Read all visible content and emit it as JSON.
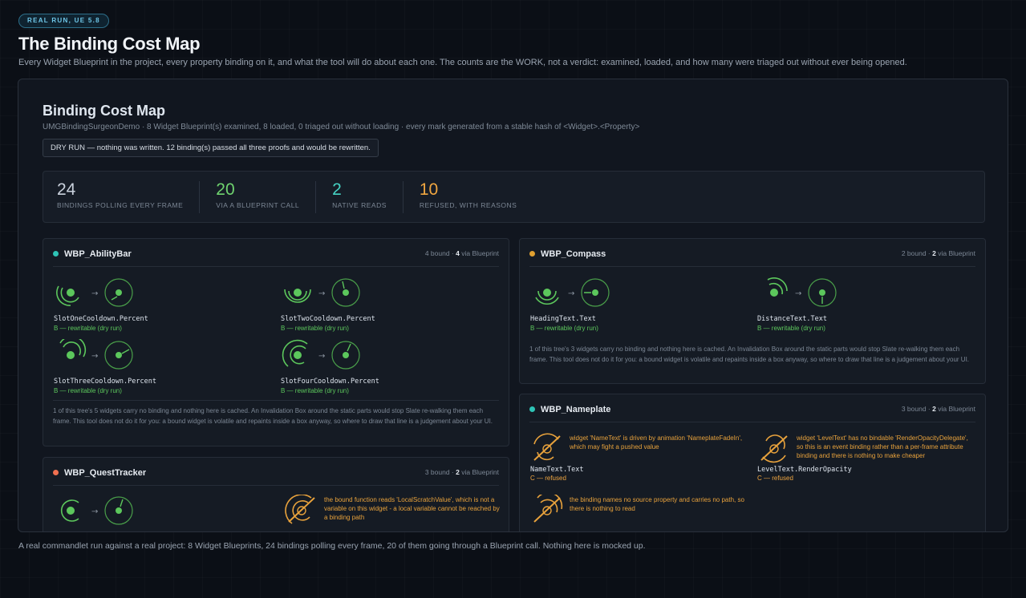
{
  "badge": "REAL RUN, UE 5.8",
  "title": "The Binding Cost Map",
  "subtitle": "Every Widget Blueprint in the project, every property binding on it, and what the tool will do about each one. The counts are the WORK, not a verdict: examined, loaded, and how many were triaged out without ever being opened.",
  "map": {
    "title": "Binding Cost Map",
    "meta": "UMGBindingSurgeonDemo · 8 Widget Blueprint(s) examined, 8 loaded, 0 triaged out without loading · every mark generated from a stable hash of <Widget>.<Property>",
    "dryrun": "DRY RUN — nothing was written. 12 binding(s) passed all three proofs and would be rewritten."
  },
  "stats": [
    {
      "value": "24",
      "label": "BINDINGS POLLING EVERY FRAME",
      "color": "#c9d1dc"
    },
    {
      "value": "20",
      "label": "VIA A BLUEPRINT CALL",
      "color": "#6fd36f"
    },
    {
      "value": "2",
      "label": "NATIVE READS",
      "color": "#46d3c4"
    },
    {
      "value": "10",
      "label": "REFUSED, WITH REASONS",
      "color": "#f0a640"
    }
  ],
  "colors": {
    "ok": "#5cc75c",
    "refused": "#f0a640",
    "teal": "#2ec4b6",
    "amber": "#e0a030",
    "coral": "#f07050"
  },
  "cards": {
    "ability": {
      "name": "WBP_AbilityBar",
      "bound": "4 bound · ",
      "via_num": "4",
      "via": " via Blueprint",
      "items": [
        {
          "prop": "SlotOneCooldown.Percent",
          "status": "B — rewritable (dry run)"
        },
        {
          "prop": "SlotTwoCooldown.Percent",
          "status": "B — rewritable (dry run)"
        },
        {
          "prop": "SlotThreeCooldown.Percent",
          "status": "B — rewritable (dry run)"
        },
        {
          "prop": "SlotFourCooldown.Percent",
          "status": "B — rewritable (dry run)"
        }
      ],
      "note": "1 of this tree's 5 widgets carry no binding and nothing here is cached. An Invalidation Box around the static parts would stop Slate re-walking them each frame. This tool does not do it for you: a bound widget is volatile and repaints inside a box anyway, so where to draw that line is a judgement about your UI."
    },
    "compass": {
      "name": "WBP_Compass",
      "bound": "2 bound · ",
      "via_num": "2",
      "via": " via Blueprint",
      "items": [
        {
          "prop": "HeadingText.Text",
          "status": "B — rewritable (dry run)"
        },
        {
          "prop": "DistanceText.Text",
          "status": "B — rewritable (dry run)"
        }
      ],
      "note": "1 of this tree's 3 widgets carry no binding and nothing here is cached. An Invalidation Box around the static parts would stop Slate re-walking them each frame. This tool does not do it for you: a bound widget is volatile and repaints inside a box anyway, so where to draw that line is a judgement about your UI."
    },
    "nameplate": {
      "name": "WBP_Nameplate",
      "bound": "3 bound · ",
      "via_num": "2",
      "via": " via Blueprint",
      "items": [
        {
          "reason": "widget 'NameText' is driven by animation 'NameplateFadeIn', which may fight a pushed value",
          "prop": "NameText.Text",
          "status": "C — refused"
        },
        {
          "reason": "widget 'LevelText' has no bindable 'RenderOpacityDelegate', so this is an event binding rather than a per-frame attribute binding and there is nothing to make cheaper",
          "prop": "LevelText.RenderOpacity",
          "status": "C — refused"
        },
        {
          "reason": "the binding names no source property and carries no path, so there is nothing to read"
        }
      ]
    },
    "quest": {
      "name": "WBP_QuestTracker",
      "bound": "3 bound · ",
      "via_num": "2",
      "via": " via Blueprint",
      "reason": "the bound function reads 'LocalScratchValue', which is not a variable on this widget - a local variable cannot be reached by a binding path"
    }
  },
  "footer": "A real commandlet run against a real project: 8 Widget Blueprints, 24 bindings polling every frame, 20 of them going through a Blueprint call. Nothing here is mocked up."
}
